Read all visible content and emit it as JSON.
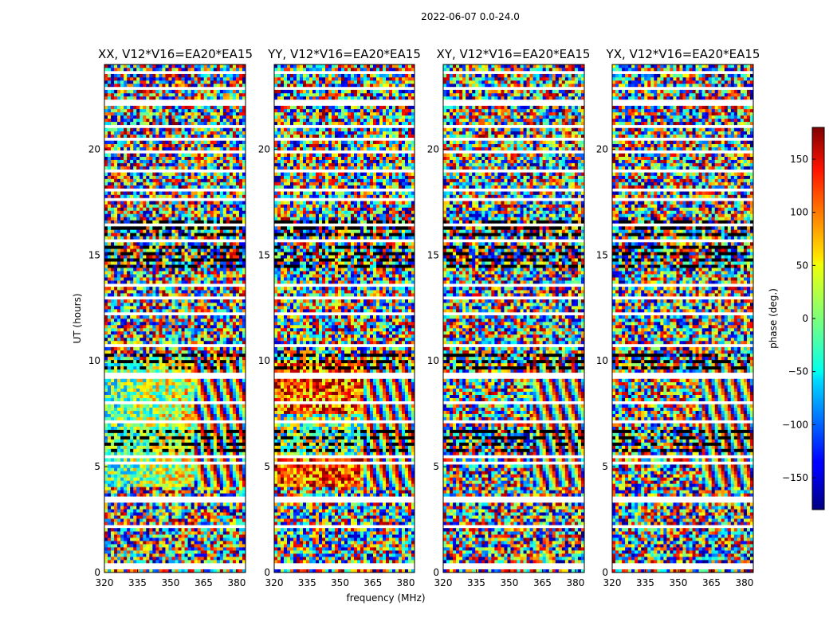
{
  "suptitle": "2022-06-07 0.0-24.0",
  "chart_data": {
    "type": "heatmap",
    "panels": [
      {
        "title": "XX, V12*V16=EA20*EA15",
        "mode": "xx"
      },
      {
        "title": "YY, V12*V16=EA20*EA15",
        "mode": "yy"
      },
      {
        "title": "XY, V12*V16=EA20*EA15",
        "mode": "xy"
      },
      {
        "title": "YX, V12*V16=EA20*EA15",
        "mode": "yx"
      }
    ],
    "xlabel": "frequency (MHz)",
    "ylabel": "UT (hours)",
    "xlim": [
      320,
      384
    ],
    "ylim": [
      0,
      24
    ],
    "xticks": [
      320,
      335,
      350,
      365,
      380
    ],
    "yticks": [
      0,
      5,
      10,
      15,
      20
    ],
    "colorbar": {
      "label": "phase (deg.)",
      "range": [
        -180,
        180
      ],
      "ticks": [
        150,
        100,
        50,
        0,
        -50,
        -100,
        -150
      ],
      "tick_labels": [
        "150",
        "100",
        "50",
        "0",
        "−50",
        "−100",
        "−150"
      ],
      "colormap": "jet"
    },
    "colors": {
      "frame": "#000000",
      "background": "#ffffff"
    }
  }
}
